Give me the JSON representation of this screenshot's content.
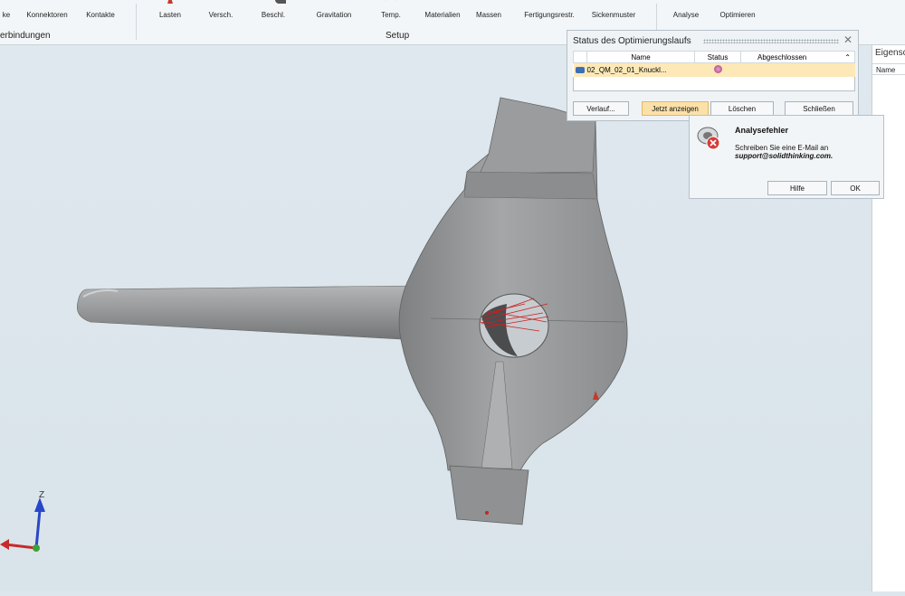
{
  "ribbon": {
    "items": [
      "ke",
      "Konnektoren",
      "Kontakte",
      "Lasten",
      "Versch.",
      "Beschl.",
      "Gravitation",
      "Temp.",
      "Materialien",
      "Massen",
      "Fertigungsrestr.",
      "Sickenmuster",
      "Analyse",
      "Optimieren"
    ],
    "groups": [
      "erbindungen",
      "Setup"
    ]
  },
  "status_dialog": {
    "title": "Status des Optimierungslaufs",
    "columns": [
      "Name",
      "Status",
      "Abgeschlossen"
    ],
    "row": {
      "name": "02_QM_02_01_Knuckl...",
      "status": "",
      "completed": ""
    },
    "buttons": {
      "history": "Verlauf...",
      "show_now": "Jetzt anzeigen",
      "delete": "Löschen",
      "close": "Schließen"
    }
  },
  "error_dialog": {
    "title": "Analysefehler",
    "message": "Schreiben Sie eine E-Mail an",
    "email": "support@solidthinking.com.",
    "help_button": "Hilfe",
    "ok_button": "OK"
  },
  "properties_panel": {
    "title": "Eigensc",
    "column": "Name"
  },
  "axis": {
    "z_label": "Z"
  },
  "colors": {
    "viewport": "#dde6ec",
    "part": "#8e9092",
    "highlight_button": "#fbe1a9",
    "error_icon": "#d83a3a"
  }
}
